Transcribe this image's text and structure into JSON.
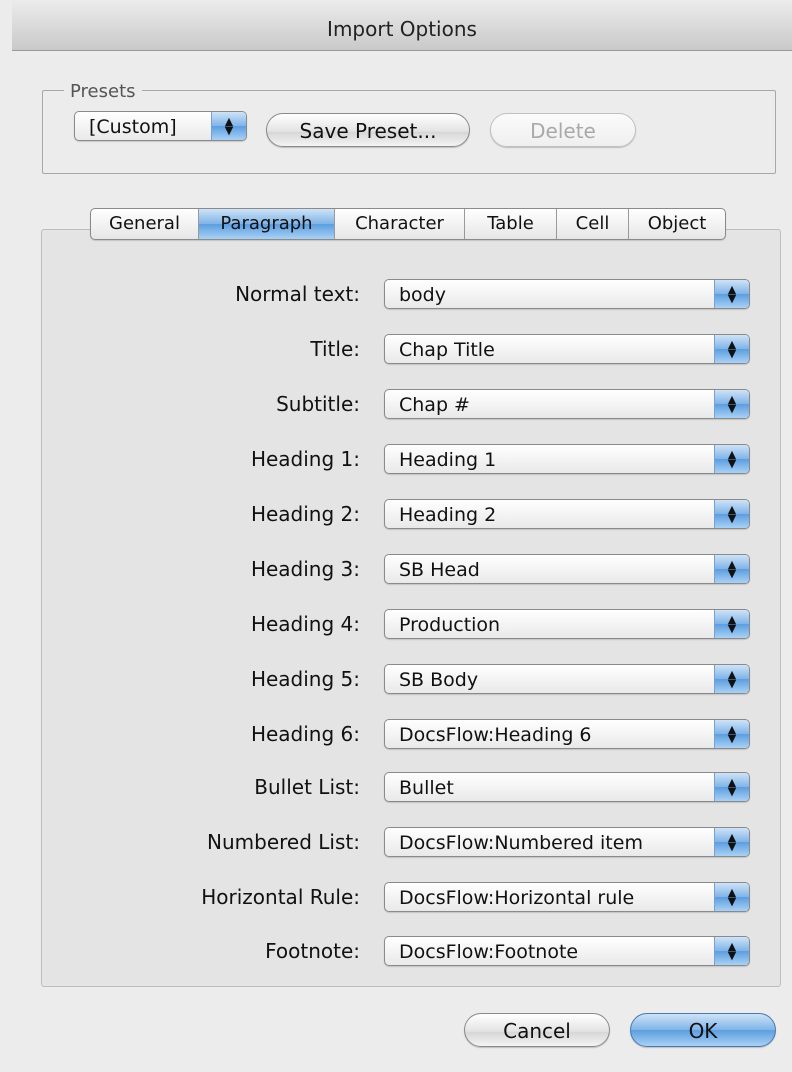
{
  "window": {
    "title": "Import Options"
  },
  "presets": {
    "legend": "Presets",
    "selected": "[Custom]",
    "save_label": "Save Preset...",
    "delete_label": "Delete"
  },
  "tabs": [
    {
      "label": "General",
      "active": false
    },
    {
      "label": "Paragraph",
      "active": true
    },
    {
      "label": "Character",
      "active": false
    },
    {
      "label": "Table",
      "active": false
    },
    {
      "label": "Cell",
      "active": false
    },
    {
      "label": "Object",
      "active": false
    }
  ],
  "rows": [
    {
      "label": "Normal text:",
      "value": "body"
    },
    {
      "label": "Title:",
      "value": "Chap Title"
    },
    {
      "label": "Subtitle:",
      "value": "Chap #"
    },
    {
      "label": "Heading 1:",
      "value": "Heading 1"
    },
    {
      "label": "Heading 2:",
      "value": "Heading 2"
    },
    {
      "label": "Heading 3:",
      "value": "SB Head"
    },
    {
      "label": "Heading 4:",
      "value": "Production"
    },
    {
      "label": "Heading 5:",
      "value": "SB Body"
    },
    {
      "label": "Heading 6:",
      "value": "DocsFlow:Heading 6"
    },
    {
      "label": "Bullet List:",
      "value": "Bullet"
    },
    {
      "label": "Numbered List:",
      "value": "DocsFlow:Numbered item"
    },
    {
      "label": "Horizontal Rule:",
      "value": "DocsFlow:Horizontal rule"
    },
    {
      "label": "Footnote:",
      "value": "DocsFlow:Footnote"
    }
  ],
  "footer": {
    "cancel_label": "Cancel",
    "ok_label": "OK"
  },
  "colors": {
    "accent": "#6aa8e6",
    "background": "#ececec"
  }
}
